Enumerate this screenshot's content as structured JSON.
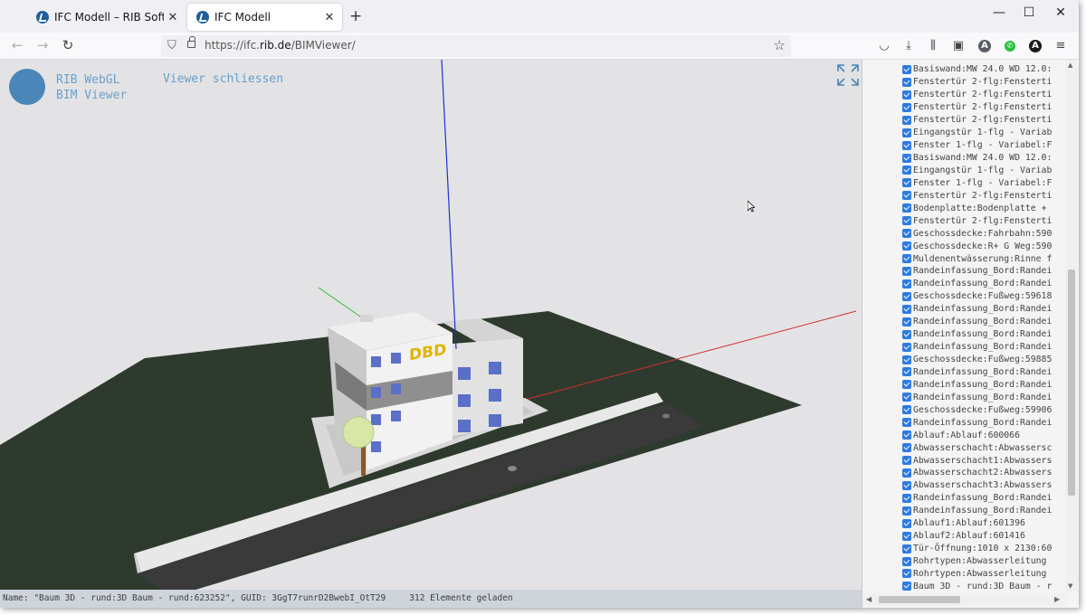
{
  "browser": {
    "tabs": [
      {
        "title": "IFC Modell – RIB Software"
      },
      {
        "title": "IFC Modell"
      }
    ],
    "new_tab_glyph": "+",
    "window_controls": [
      "—",
      "☐",
      "✕"
    ],
    "address": {
      "prefix": "https://ifc.",
      "domain": "rib.de",
      "path": "/BIMViewer/"
    },
    "toolbar_icons": [
      "pocket-icon",
      "download-icon",
      "library-icon",
      "sidebar-icon",
      "account-icon",
      "whatsapp-icon",
      "extension-icon",
      "menu-icon"
    ],
    "account_letter": "A"
  },
  "viewer": {
    "logo_line1": "RIB WebGL",
    "logo_line2": "BIM Viewer",
    "close_label": "Viewer schliessen",
    "building_sign": "DBD",
    "status": {
      "selection": "Name: \"Baum 3D - rund:3D Baum - rund:623252\", GUID: 3GgT7runrD2BwebI_OtT29",
      "loaded": "312 Elemente geladen"
    },
    "colors": {
      "background": "#e3e3e5",
      "ground": "#2f3a2e",
      "road": "#3a3a3a",
      "axis_x": "#d03030",
      "axis_y": "#30c030",
      "axis_z": "#2030d0",
      "accent_text": "#6a9fc9",
      "sign": "#e0b400"
    }
  },
  "element_list": [
    "Basiswand:MW 24.0 WD 12.0:",
    "Fenstertür 2-flg:Fensterti",
    "Fenstertür 2-flg:Fensterti",
    "Fenstertür 2-flg:Fensterti",
    "Fenstertür 2-flg:Fensterti",
    "Eingangstür 1-flg - Variab",
    "Fenster 1-flg - Variabel:F",
    "Basiswand:MW 24.0 WD 12.0:",
    "Eingangstür 1-flg - Variab",
    "Fenster 1-flg - Variabel:F",
    "Fenstertür 2-flg:Fensterti",
    "Bodenplatte:Bodenplatte +",
    "Fenstertür 2-flg:Fensterti",
    "Geschossdecke:Fahrbahn:590",
    "Geschossdecke:R+ G Weg:590",
    "Muldenentwässerung:Rinne f",
    "Randeinfassung_Bord:Randei",
    "Randeinfassung_Bord:Randei",
    "Geschossdecke:Fußweg:59618",
    "Randeinfassung_Bord:Randei",
    "Randeinfassung_Bord:Randei",
    "Randeinfassung_Bord:Randei",
    "Randeinfassung_Bord:Randei",
    "Geschossdecke:Fußweg:59885",
    "Randeinfassung_Bord:Randei",
    "Randeinfassung_Bord:Randei",
    "Randeinfassung_Bord:Randei",
    "Geschossdecke:Fußweg:59906",
    "Randeinfassung_Bord:Randei",
    "Ablauf:Ablauf:600066",
    "Abwasserschacht:Abwassersc",
    "Abwasserschacht1:Abwassers",
    "Abwasserschacht2:Abwassers",
    "Abwasserschacht3:Abwassers",
    "Randeinfassung_Bord:Randei",
    "Randeinfassung_Bord:Randei",
    "Ablauf1:Ablauf:601396",
    "Ablauf2:Ablauf:601416",
    "Tür-Öffnung:1010 x 2130:60",
    "Rohrtypen:Abwasserleitung",
    "Rohrtypen:Abwasserleitung",
    "Baum 3D - rund:3D Baum - r"
  ]
}
